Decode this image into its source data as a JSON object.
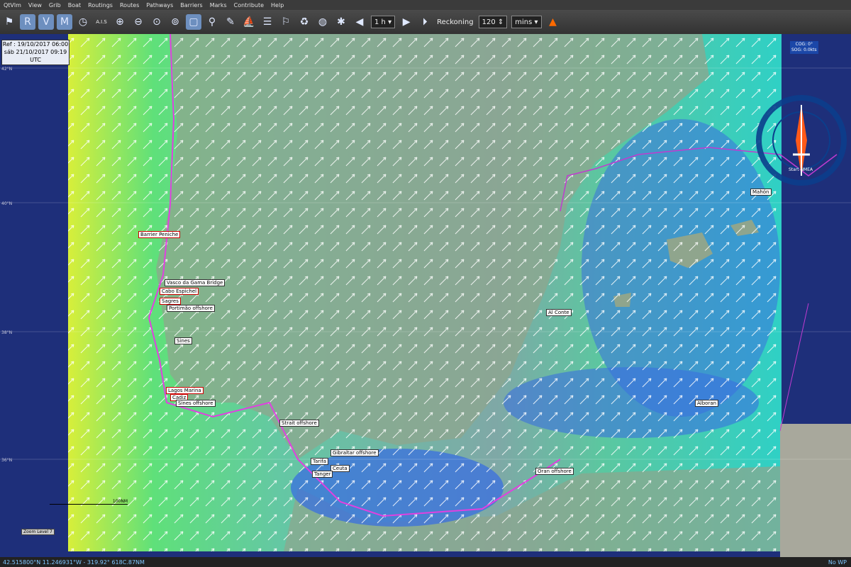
{
  "menu": [
    "QtVlm",
    "View",
    "Grib",
    "Boat",
    "Routings",
    "Routes",
    "Pathways",
    "Barriers",
    "Marks",
    "Contribute",
    "Help"
  ],
  "toolbar": {
    "grib_label": "A.I.S",
    "timestep": "1 h",
    "reckoning_label": "Reckoning",
    "reckoning_value": "120",
    "reckoning_unit": "mins"
  },
  "date_box": {
    "ref": "Ref : 19/10/2017 06:00",
    "current": "sáb 21/10/2017 09:19",
    "tz": "UTC"
  },
  "compass": {
    "cog": "COG: 0°",
    "sog": "SOG: 0.0kts",
    "start": "Start NMEA"
  },
  "lat_labels": [
    "42°N",
    "40°N",
    "38°N",
    "36°N"
  ],
  "labels_red": [
    "Barrier Peniche",
    "Cabo Espichel",
    "Sagres",
    "Lagos Marina",
    "Cadiz"
  ],
  "labels_white": [
    "Vasco da Gama Bridge",
    "Portimão offshore",
    "Sines",
    "Sines offshore",
    "Strait offshore",
    "Tarifa",
    "Ceuta",
    "Tanger",
    "Gibraltar offshore",
    "Oran offshore",
    "Mahón",
    "Al Conte",
    "Alboran"
  ],
  "zoom": "Zoom Level 7",
  "zoom_scale": "100NM",
  "status": {
    "coords": "42.515800°N 11.246931°W - 319.92° 618C.87NM",
    "right": "No WP"
  },
  "colors": {
    "ocean_deep": "#1e2f7a",
    "wind_low": "#3a6fe0",
    "wind_mid": "#37c6a0",
    "wind_high": "#d8ef3a",
    "land": "#8aa088"
  }
}
